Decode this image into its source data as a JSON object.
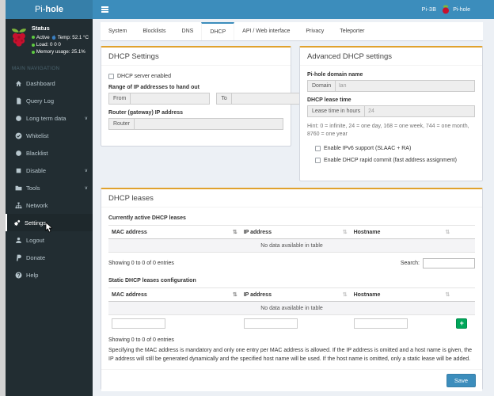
{
  "navbar": {
    "brand_light": "Pi-",
    "brand_bold": "hole",
    "hostname": "Pi-3B",
    "session_label": "Pi-hole"
  },
  "sidebar": {
    "status": {
      "title": "Status",
      "active": "Active",
      "temp": "Temp: 52.1 °C",
      "load": "Load: 0 0 0",
      "memory": "Memory usage: 25.1%"
    },
    "nav_label": "MAIN NAVIGATION",
    "items": [
      {
        "label": "Dashboard"
      },
      {
        "label": "Query Log"
      },
      {
        "label": "Long term data",
        "chevron": true
      },
      {
        "label": "Whitelist"
      },
      {
        "label": "Blacklist"
      },
      {
        "label": "Disable",
        "chevron": true
      },
      {
        "label": "Tools",
        "chevron": true
      },
      {
        "label": "Network"
      },
      {
        "label": "Settings",
        "active": true
      },
      {
        "label": "Logout"
      },
      {
        "label": "Donate"
      },
      {
        "label": "Help"
      }
    ]
  },
  "tabs": {
    "items": [
      "System",
      "Blocklists",
      "DNS",
      "DHCP",
      "API / Web interface",
      "Privacy",
      "Teleporter"
    ],
    "active": "DHCP"
  },
  "dhcp_settings": {
    "title": "DHCP Settings",
    "enable_checkbox": "DHCP server enabled",
    "range_label": "Range of IP addresses to hand out",
    "from_addon": "From",
    "to_addon": "To",
    "router_label": "Router (gateway) IP address",
    "router_addon": "Router"
  },
  "advanced": {
    "title": "Advanced DHCP settings",
    "domain_label": "Pi-hole domain name",
    "domain_addon": "Domain",
    "domain_value": "lan",
    "lease_label": "DHCP lease time",
    "lease_addon": "Lease time in hours",
    "lease_value": "24",
    "hint": "Hint: 0 = infinite, 24 = one day, 168 = one week, 744 = one month, 8760 = one year",
    "ipv6_checkbox": "Enable IPv6 support (SLAAC + RA)",
    "rapid_checkbox": "Enable DHCP rapid commit (fast address assignment)"
  },
  "leases": {
    "title": "DHCP leases",
    "active_section": "Currently active DHCP leases",
    "static_section": "Static DHCP leases configuration",
    "columns": [
      "MAC address",
      "IP address",
      "Hostname"
    ],
    "empty_text": "No data available in table",
    "showing_text": "Showing 0 to 0 of 0 entries",
    "search_label": "Search:",
    "note": "Specifying the MAC address is mandatory and only one entry per MAC address is allowed. If the IP address is omitted and a host name is given, the IP address will still be generated dynamically and the specified host name will be used. If the host name is omitted, only a static lease will be added.",
    "add_button": "+",
    "save_button": "Save"
  },
  "icons": {
    "chevron": "∨",
    "sort": "⇅"
  },
  "colors": {
    "navbar": "#3c8dbc",
    "brand_bg": "#367fa9",
    "sidebar_bg": "#222d32",
    "content_bg": "#ecf0f5",
    "box_top_border": "#e0a22e",
    "add_green": "#00a65a",
    "save_blue": "#3c8dbc",
    "status_green": "#5ec940",
    "temp_blue": "#3a7fc2"
  }
}
